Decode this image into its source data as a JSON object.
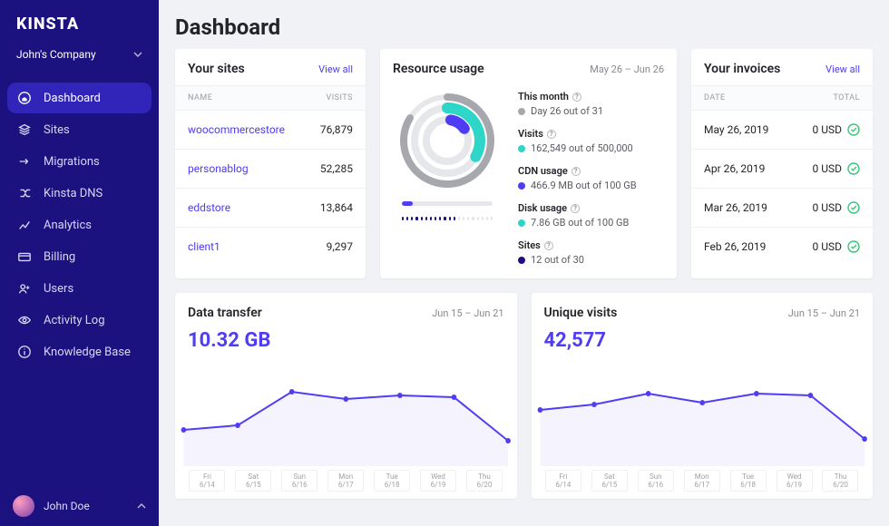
{
  "colors": {
    "accent": "#4f3df5",
    "teal": "#2ed6c8",
    "navy": "#1b1280",
    "green": "#35c77a",
    "grey": "#a7a8ae"
  },
  "sidebar": {
    "logo": "KINSTA",
    "company": "John's Company",
    "items": [
      {
        "id": "dashboard",
        "label": "Dashboard",
        "icon": "home"
      },
      {
        "id": "sites",
        "label": "Sites",
        "icon": "stack"
      },
      {
        "id": "migrations",
        "label": "Migrations",
        "icon": "migrate"
      },
      {
        "id": "dns",
        "label": "Kinsta DNS",
        "icon": "dns"
      },
      {
        "id": "analytics",
        "label": "Analytics",
        "icon": "chart"
      },
      {
        "id": "billing",
        "label": "Billing",
        "icon": "card"
      },
      {
        "id": "users",
        "label": "Users",
        "icon": "users"
      },
      {
        "id": "activity",
        "label": "Activity Log",
        "icon": "eye"
      },
      {
        "id": "kb",
        "label": "Knowledge Base",
        "icon": "info"
      }
    ],
    "user": "John Doe"
  },
  "page_title": "Dashboard",
  "sites_card": {
    "title": "Your sites",
    "view_all": "View all",
    "col_name": "NAME",
    "col_visits": "VISITS",
    "rows": [
      {
        "name": "woocommercestore",
        "visits": "76,879"
      },
      {
        "name": "personablog",
        "visits": "52,285"
      },
      {
        "name": "eddstore",
        "visits": "13,864"
      },
      {
        "name": "client1",
        "visits": "9,297"
      }
    ]
  },
  "resource_card": {
    "title": "Resource usage",
    "range": "May 26 – Jun 26",
    "metrics": [
      {
        "label": "This month",
        "dot": "#a7a8ae",
        "value": "Day 26 out of 31"
      },
      {
        "label": "Visits",
        "dot": "#2ed6c8",
        "value": "162,549 out of 500,000"
      },
      {
        "label": "CDN usage",
        "dot": "#4f3df5",
        "value": "466.9 MB out of 100 GB"
      },
      {
        "label": "Disk usage",
        "dot": "#2ed6c8",
        "value": "7.86 GB out of 100 GB"
      },
      {
        "label": "Sites",
        "dot": "#1b1280",
        "value": "12 out of 30"
      }
    ]
  },
  "invoices_card": {
    "title": "Your invoices",
    "view_all": "View all",
    "col_date": "DATE",
    "col_total": "TOTAL",
    "rows": [
      {
        "date": "May 26, 2019",
        "total": "0 USD"
      },
      {
        "date": "Apr 26, 2019",
        "total": "0 USD"
      },
      {
        "date": "Mar 26, 2019",
        "total": "0 USD"
      },
      {
        "date": "Feb 26, 2019",
        "total": "0 USD"
      }
    ]
  },
  "transfer_card": {
    "title": "Data transfer",
    "range": "Jun 15 – Jun 21",
    "value": "10.32 GB"
  },
  "visits_card": {
    "title": "Unique visits",
    "range": "Jun 15 – Jun 21",
    "value": "42,577"
  },
  "xticks": [
    {
      "d": "Fri",
      "dt": "6/14"
    },
    {
      "d": "Sat",
      "dt": "6/15"
    },
    {
      "d": "Sun",
      "dt": "6/16"
    },
    {
      "d": "Mon",
      "dt": "6/17"
    },
    {
      "d": "Tue",
      "dt": "6/18"
    },
    {
      "d": "Wed",
      "dt": "6/19"
    },
    {
      "d": "Thu",
      "dt": "6/20"
    }
  ],
  "chart_data": [
    {
      "type": "line",
      "title": "Data transfer",
      "x": [
        "6/14",
        "6/15",
        "6/16",
        "6/17",
        "6/18",
        "6/19",
        "6/20"
      ],
      "values": [
        30,
        35,
        72,
        64,
        68,
        66,
        18
      ],
      "ylabel": "",
      "xlabel": "",
      "ylim": [
        0,
        100
      ]
    },
    {
      "type": "line",
      "title": "Unique visits",
      "x": [
        "6/14",
        "6/15",
        "6/16",
        "6/17",
        "6/18",
        "6/19",
        "6/20"
      ],
      "values": [
        52,
        58,
        70,
        60,
        70,
        68,
        20
      ],
      "ylabel": "",
      "xlabel": "",
      "ylim": [
        0,
        100
      ]
    }
  ]
}
